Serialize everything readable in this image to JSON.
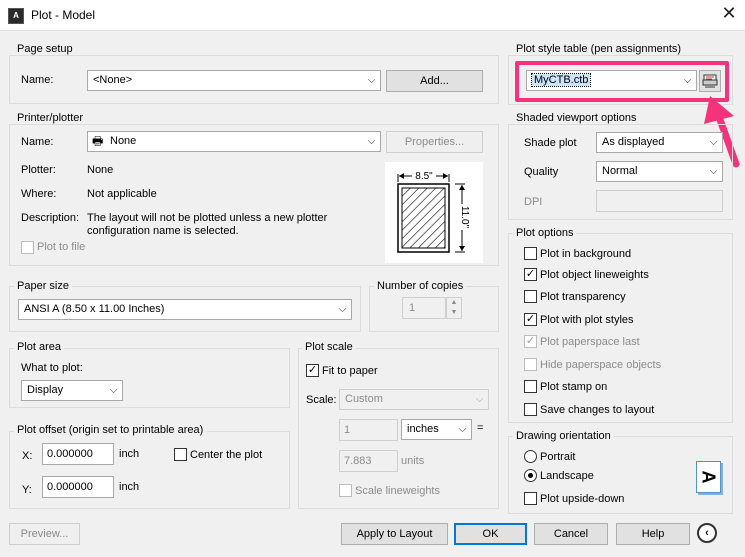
{
  "window": {
    "title": "Plot - Model",
    "app_icon_text": "A"
  },
  "page_setup": {
    "group_label": "Page setup",
    "name_label": "Name:",
    "name_value": "<None>",
    "add_button": "Add..."
  },
  "printer": {
    "group_label": "Printer/plotter",
    "name_label": "Name:",
    "name_value": "None",
    "properties_button": "Properties...",
    "plotter_label": "Plotter:",
    "plotter_value": "None",
    "where_label": "Where:",
    "where_value": "Not applicable",
    "description_label": "Description:",
    "description_line1": "The layout will not be plotted unless a new plotter",
    "description_line2": "configuration name is selected.",
    "plot_to_file": "Plot to file",
    "preview_width": "8.5\"",
    "preview_height": "11.0\""
  },
  "paper_size": {
    "group_label": "Paper size",
    "value": "ANSI A (8.50 x 11.00 Inches)"
  },
  "copies": {
    "group_label": "Number of copies",
    "value": "1"
  },
  "plot_area": {
    "group_label": "Plot area",
    "what_label": "What to plot:",
    "what_value": "Display"
  },
  "plot_offset": {
    "group_label": "Plot offset (origin set to printable area)",
    "x_label": "X:",
    "x_value": "0.000000",
    "x_unit": "inch",
    "y_label": "Y:",
    "y_value": "0.000000",
    "y_unit": "inch",
    "center_label": "Center the plot"
  },
  "plot_scale": {
    "group_label": "Plot scale",
    "fit_label": "Fit to paper",
    "scale_label": "Scale:",
    "scale_value": "Custom",
    "value1": "1",
    "unit_value": "inches",
    "equals": "=",
    "value2": "7.883",
    "units_label": "units",
    "scale_lineweights": "Scale lineweights"
  },
  "plot_style": {
    "group_label": "Plot style table (pen assignments)",
    "value": "MyCTB.ctb",
    "edit_icon": "plot-style-editor-icon"
  },
  "shaded": {
    "group_label": "Shaded viewport options",
    "shade_label": "Shade plot",
    "shade_value": "As displayed",
    "quality_label": "Quality",
    "quality_value": "Normal",
    "dpi_label": "DPI"
  },
  "plot_options": {
    "group_label": "Plot options",
    "items": [
      {
        "label": "Plot in background",
        "checked": false,
        "disabled": false
      },
      {
        "label": "Plot object lineweights",
        "checked": true,
        "disabled": false
      },
      {
        "label": "Plot transparency",
        "checked": false,
        "disabled": false
      },
      {
        "label": "Plot with plot styles",
        "checked": true,
        "disabled": false
      },
      {
        "label": "Plot paperspace last",
        "checked": true,
        "disabled": true
      },
      {
        "label": "Hide paperspace objects",
        "checked": false,
        "disabled": true
      },
      {
        "label": "Plot stamp on",
        "checked": false,
        "disabled": false
      },
      {
        "label": "Save changes to layout",
        "checked": false,
        "disabled": false
      }
    ]
  },
  "orientation": {
    "group_label": "Drawing orientation",
    "portrait": "Portrait",
    "landscape": "Landscape",
    "upside_down": "Plot upside-down",
    "icon_letter": "A"
  },
  "footer": {
    "preview": "Preview...",
    "apply": "Apply to Layout",
    "ok": "OK",
    "cancel": "Cancel",
    "help": "Help"
  },
  "colors": {
    "highlight": "#f5337a",
    "focus": "#0078d7"
  }
}
